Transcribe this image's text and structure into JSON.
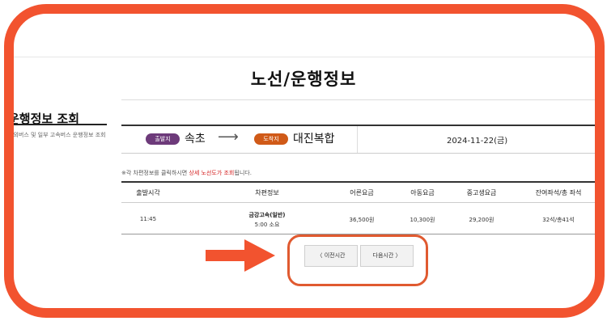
{
  "page": {
    "title": "노선/운행정보"
  },
  "sidebar": {
    "title": "운행정보 조회",
    "desc": "시외버스 및 일부 고속버스 운행정보 조회"
  },
  "route": {
    "departure_badge": "출발지",
    "departure": "속초",
    "arrow": "⟶",
    "arrival_badge": "도착지",
    "arrival": "대진복합",
    "date": "2024-11-22(금)"
  },
  "notice": {
    "prefix": "※각 차편정보를 클릭하시면 ",
    "highlight": "상세 노선도가 조회",
    "suffix": "됩니다."
  },
  "table": {
    "headers": [
      "출발시각",
      "차편정보",
      "어른요금",
      "아동요금",
      "중고생요금",
      "잔여좌석/총 좌석"
    ],
    "rows": [
      {
        "time": "11:45",
        "bus": "금강고속(일반)",
        "duration": "5:00 소요",
        "adult": "36,500원",
        "child": "10,300원",
        "student": "29,200원",
        "seats": "32석/총41석"
      }
    ]
  },
  "buttons": {
    "prev": "〈  이전시간",
    "next": "다음시간  〉"
  },
  "colors": {
    "frame": "#f2532f",
    "departure_badge": "#6d3a7a",
    "arrival_badge": "#d05a18",
    "notice_highlight": "#d42020"
  }
}
